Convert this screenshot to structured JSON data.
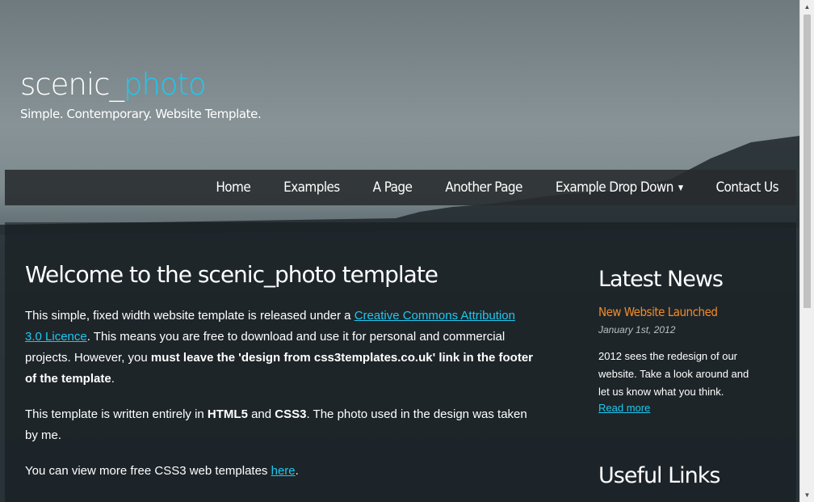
{
  "header": {
    "logo_main": "scenic_",
    "logo_accent": "photo",
    "slogan": "Simple. Contemporary. Website Template."
  },
  "nav": {
    "items": [
      {
        "label": "Home"
      },
      {
        "label": "Examples"
      },
      {
        "label": "A Page"
      },
      {
        "label": "Another Page"
      },
      {
        "label": "Example Drop Down"
      },
      {
        "label": "Contact Us"
      }
    ]
  },
  "main": {
    "title": "Welcome to the scenic_photo template",
    "p1_a": "This simple, fixed width website template is released under a ",
    "p1_link": "Creative Commons Attribution 3.0 Licence",
    "p1_b": ". This means you are free to download and use it for personal and commercial projects. However, you ",
    "p1_bold": "must leave the 'design from css3templates.co.uk' link in the footer of the template",
    "p1_c": ".",
    "p2_a": "This template is written entirely in ",
    "p2_b1": "HTML5",
    "p2_and": " and ",
    "p2_b2": "CSS3",
    "p2_c": ". The photo used in the design was taken by me.",
    "p3_a": "You can view more free CSS3 web templates ",
    "p3_link": "here",
    "p3_c": "."
  },
  "sidebar": {
    "latest_title": "Latest News",
    "news_title": "New Website Launched",
    "news_date": "January 1st, 2012",
    "news_body": "2012 sees the redesign of our website. Take a look around and let us know what you think.",
    "news_link": "Read more",
    "useful_title": "Useful Links"
  },
  "colors": {
    "accent": "#1ec8f0",
    "news_title": "#f28c28"
  }
}
